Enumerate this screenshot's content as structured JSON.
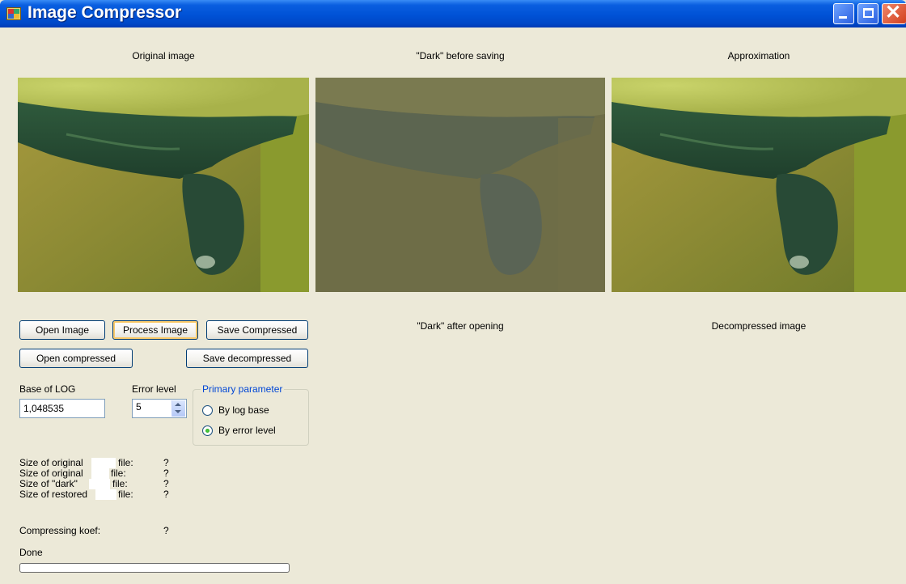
{
  "window": {
    "title": "Image Compressor"
  },
  "images": {
    "original_caption": "Original image",
    "dark_before_caption": "\"Dark\" before saving",
    "approximation_caption": "Approximation",
    "dark_after_caption": "\"Dark\" after opening",
    "decompressed_caption": "Decompressed image"
  },
  "buttons": {
    "open_image": "Open Image",
    "process_image": "Process Image",
    "save_compressed": "Save Compressed",
    "open_compressed": "Open compressed",
    "save_decompressed": "Save decompressed"
  },
  "params": {
    "base_log_label": "Base of LOG",
    "base_log_value": "1,048535",
    "error_level_label": "Error level",
    "error_level_value": "5"
  },
  "primary_parameter": {
    "legend": "Primary parameter",
    "options": [
      {
        "label": "By log base",
        "selected": false
      },
      {
        "label": "By error level",
        "selected": true
      }
    ]
  },
  "stats": {
    "rows": [
      {
        "label": "Size of original",
        "suffix": "file:",
        "value": "?"
      },
      {
        "label": "Size of original",
        "suffix": "file:",
        "value": "?"
      },
      {
        "label": "Size of \"dark\"",
        "suffix": "file:",
        "value": "?"
      },
      {
        "label": "Size of restored",
        "suffix": "file:",
        "value": "?"
      }
    ],
    "koef_label": "Compressing koef:",
    "koef_value": "?"
  },
  "status": {
    "text": "Done",
    "progress": 0
  },
  "colors": {
    "accent": "#0046d5",
    "titlebar": "#0052d6",
    "background": "#ece9d8"
  }
}
